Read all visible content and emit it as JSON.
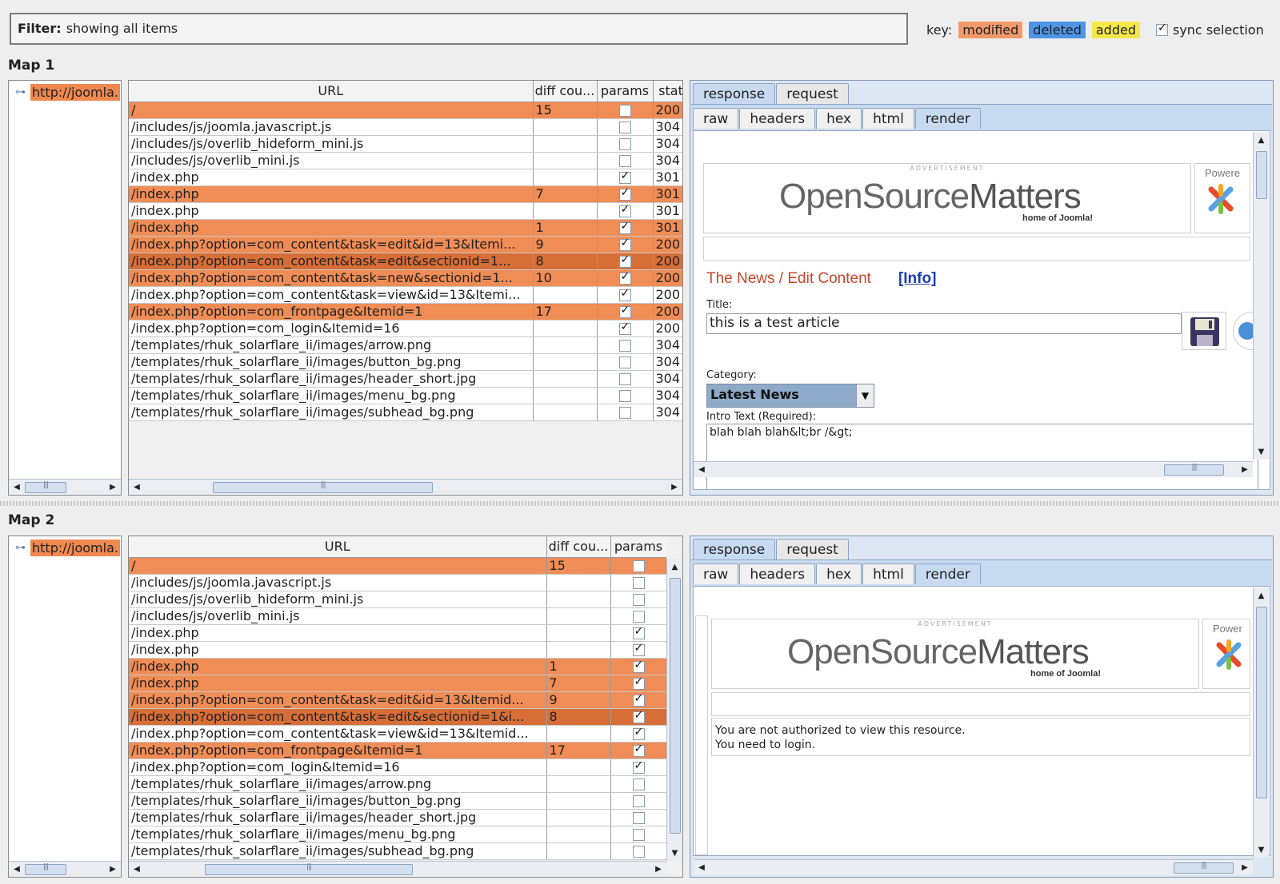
{
  "filter": {
    "label": "Filter:",
    "value": "showing all items"
  },
  "key": {
    "label": "key:",
    "modified": "modified",
    "deleted": "deleted",
    "added": "added",
    "colors": {
      "modified": "#f39a6b",
      "deleted": "#4f95e6",
      "added": "#f5e84a"
    },
    "sync_label": "sync selection",
    "sync_checked": true
  },
  "map1": {
    "label": "Map 1",
    "tree_node": "http://joomla.",
    "columns": [
      "URL",
      "diff cou...",
      "params",
      "stat"
    ],
    "rows": [
      {
        "url": "/",
        "diff": "15",
        "params": false,
        "status": "200",
        "state": "mod"
      },
      {
        "url": "/includes/js/joomla.javascript.js",
        "diff": "",
        "params": false,
        "status": "304",
        "state": ""
      },
      {
        "url": "/includes/js/overlib_hideform_mini.js",
        "diff": "",
        "params": false,
        "status": "304",
        "state": ""
      },
      {
        "url": "/includes/js/overlib_mini.js",
        "diff": "",
        "params": false,
        "status": "304",
        "state": ""
      },
      {
        "url": "/index.php",
        "diff": "",
        "params": true,
        "status": "301",
        "state": ""
      },
      {
        "url": "/index.php",
        "diff": "7",
        "params": true,
        "status": "301",
        "state": "mod"
      },
      {
        "url": "/index.php",
        "diff": "",
        "params": true,
        "status": "301",
        "state": ""
      },
      {
        "url": "/index.php",
        "diff": "1",
        "params": true,
        "status": "301",
        "state": "mod"
      },
      {
        "url": "/index.php?option=com_content&task=edit&id=13&Itemi...",
        "diff": "9",
        "params": true,
        "status": "200",
        "state": "mod"
      },
      {
        "url": "/index.php?option=com_content&task=edit&sectionid=1...",
        "diff": "8",
        "params": true,
        "status": "200",
        "state": "sel"
      },
      {
        "url": "/index.php?option=com_content&task=new&sectionid=1...",
        "diff": "10",
        "params": true,
        "status": "200",
        "state": "mod"
      },
      {
        "url": "/index.php?option=com_content&task=view&id=13&Itemi...",
        "diff": "",
        "params": true,
        "status": "200",
        "state": ""
      },
      {
        "url": "/index.php?option=com_frontpage&Itemid=1",
        "diff": "17",
        "params": true,
        "status": "200",
        "state": "mod"
      },
      {
        "url": "/index.php?option=com_login&Itemid=16",
        "diff": "",
        "params": true,
        "status": "200",
        "state": ""
      },
      {
        "url": "/templates/rhuk_solarflare_ii/images/arrow.png",
        "diff": "",
        "params": false,
        "status": "304",
        "state": ""
      },
      {
        "url": "/templates/rhuk_solarflare_ii/images/button_bg.png",
        "diff": "",
        "params": false,
        "status": "304",
        "state": ""
      },
      {
        "url": "/templates/rhuk_solarflare_ii/images/header_short.jpg",
        "diff": "",
        "params": false,
        "status": "304",
        "state": ""
      },
      {
        "url": "/templates/rhuk_solarflare_ii/images/menu_bg.png",
        "diff": "",
        "params": false,
        "status": "304",
        "state": ""
      },
      {
        "url": "/templates/rhuk_solarflare_ii/images/subhead_bg.png",
        "diff": "",
        "params": false,
        "status": "304",
        "state": ""
      }
    ],
    "tabs": [
      "response",
      "request"
    ],
    "subtabs": [
      "raw",
      "headers",
      "hex",
      "html",
      "render"
    ],
    "render": {
      "ad_caption": "ADVERTISEMENT",
      "logo_open": "OpenSource",
      "logo_matters": "Matters",
      "logo_tag": "home of Joomla!",
      "powered": "Powere",
      "heading": "The News / Edit  Content",
      "info_link": "[Info]",
      "title_label": "Title:",
      "title_value": "this is a test article",
      "category_label": "Category:",
      "category_value": "Latest News",
      "intro_label": "Intro Text (Required):",
      "intro_value": "blah blah blah&lt;br /&gt;"
    }
  },
  "map2": {
    "label": "Map 2",
    "tree_node": "http://joomla.",
    "columns": [
      "URL",
      "diff cou...",
      "params"
    ],
    "rows": [
      {
        "url": "/",
        "diff": "15",
        "params": false,
        "state": "mod"
      },
      {
        "url": "/includes/js/joomla.javascript.js",
        "diff": "",
        "params": false,
        "state": ""
      },
      {
        "url": "/includes/js/overlib_hideform_mini.js",
        "diff": "",
        "params": false,
        "state": ""
      },
      {
        "url": "/includes/js/overlib_mini.js",
        "diff": "",
        "params": false,
        "state": ""
      },
      {
        "url": "/index.php",
        "diff": "",
        "params": true,
        "state": ""
      },
      {
        "url": "/index.php",
        "diff": "",
        "params": true,
        "state": ""
      },
      {
        "url": "/index.php",
        "diff": "1",
        "params": true,
        "state": "mod"
      },
      {
        "url": "/index.php",
        "diff": "7",
        "params": true,
        "state": "mod"
      },
      {
        "url": "/index.php?option=com_content&task=edit&id=13&Itemid...",
        "diff": "9",
        "params": true,
        "state": "mod"
      },
      {
        "url": "/index.php?option=com_content&task=edit&sectionid=1&i...",
        "diff": "8",
        "params": true,
        "state": "sel"
      },
      {
        "url": "/index.php?option=com_content&task=view&id=13&Itemid...",
        "diff": "",
        "params": true,
        "state": ""
      },
      {
        "url": "/index.php?option=com_frontpage&Itemid=1",
        "diff": "17",
        "params": true,
        "state": "mod"
      },
      {
        "url": "/index.php?option=com_login&Itemid=16",
        "diff": "",
        "params": true,
        "state": ""
      },
      {
        "url": "/templates/rhuk_solarflare_ii/images/arrow.png",
        "diff": "",
        "params": false,
        "state": ""
      },
      {
        "url": "/templates/rhuk_solarflare_ii/images/button_bg.png",
        "diff": "",
        "params": false,
        "state": ""
      },
      {
        "url": "/templates/rhuk_solarflare_ii/images/header_short.jpg",
        "diff": "",
        "params": false,
        "state": ""
      },
      {
        "url": "/templates/rhuk_solarflare_ii/images/menu_bg.png",
        "diff": "",
        "params": false,
        "state": ""
      },
      {
        "url": "/templates/rhuk_solarflare_ii/images/subhead_bg.png",
        "diff": "",
        "params": false,
        "state": ""
      }
    ],
    "tabs": [
      "response",
      "request"
    ],
    "subtabs": [
      "raw",
      "headers",
      "hex",
      "html",
      "render"
    ],
    "render": {
      "ad_caption": "ADVERTISEMENT",
      "logo_open": "OpenSource",
      "logo_matters": "Matters",
      "logo_tag": "home of Joomla!",
      "powered": "Power",
      "msg_line1": "You are not authorized to view this resource.",
      "msg_line2": "You need to login."
    }
  }
}
